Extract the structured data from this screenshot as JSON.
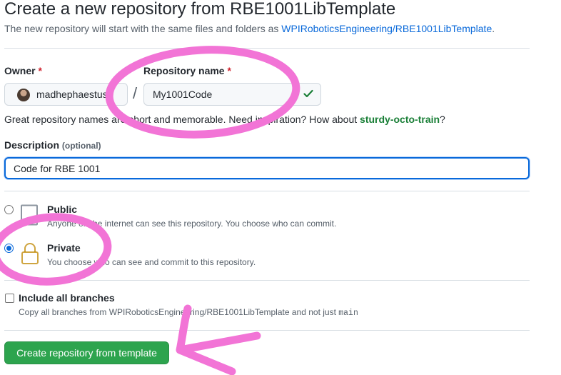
{
  "header": {
    "title": "Create a new repository from RBE1001LibTemplate",
    "subtitle_prefix": "The new repository will start with the same files and folders as ",
    "template_link": "WPIRoboticsEngineering/RBE1001LibTemplate",
    "subtitle_suffix": "."
  },
  "owner": {
    "label": "Owner",
    "required_mark": "*",
    "value": "madhephaestus"
  },
  "separator": "/",
  "repo_name": {
    "label": "Repository name",
    "required_mark": "*",
    "value": "My1001Code",
    "status_icon": "check-icon",
    "status_color": "#1a7f37"
  },
  "name_hint": {
    "prefix": "Great repository names are short and memorable. Need inspiration? How about ",
    "suggestion": "sturdy-octo-train",
    "suffix": "?"
  },
  "description": {
    "label": "Description",
    "optional_text": "(optional)",
    "value": "Code for RBE 1001"
  },
  "visibility": {
    "public": {
      "title": "Public",
      "description": "Anyone on the internet can see this repository. You choose who can commit.",
      "icon": "repo-icon",
      "selected": false
    },
    "private": {
      "title": "Private",
      "description": "You choose who can see and commit to this repository.",
      "icon": "lock-icon",
      "selected": true
    }
  },
  "branches": {
    "title": "Include all branches",
    "description_prefix": "Copy all branches from WPIRoboticsEngineering/RBE1001LibTemplate and not just ",
    "branch_name": "main",
    "checked": false
  },
  "submit": {
    "label": "Create repository from template",
    "color": "#2da44e"
  },
  "annotation_color": "#f274d6"
}
